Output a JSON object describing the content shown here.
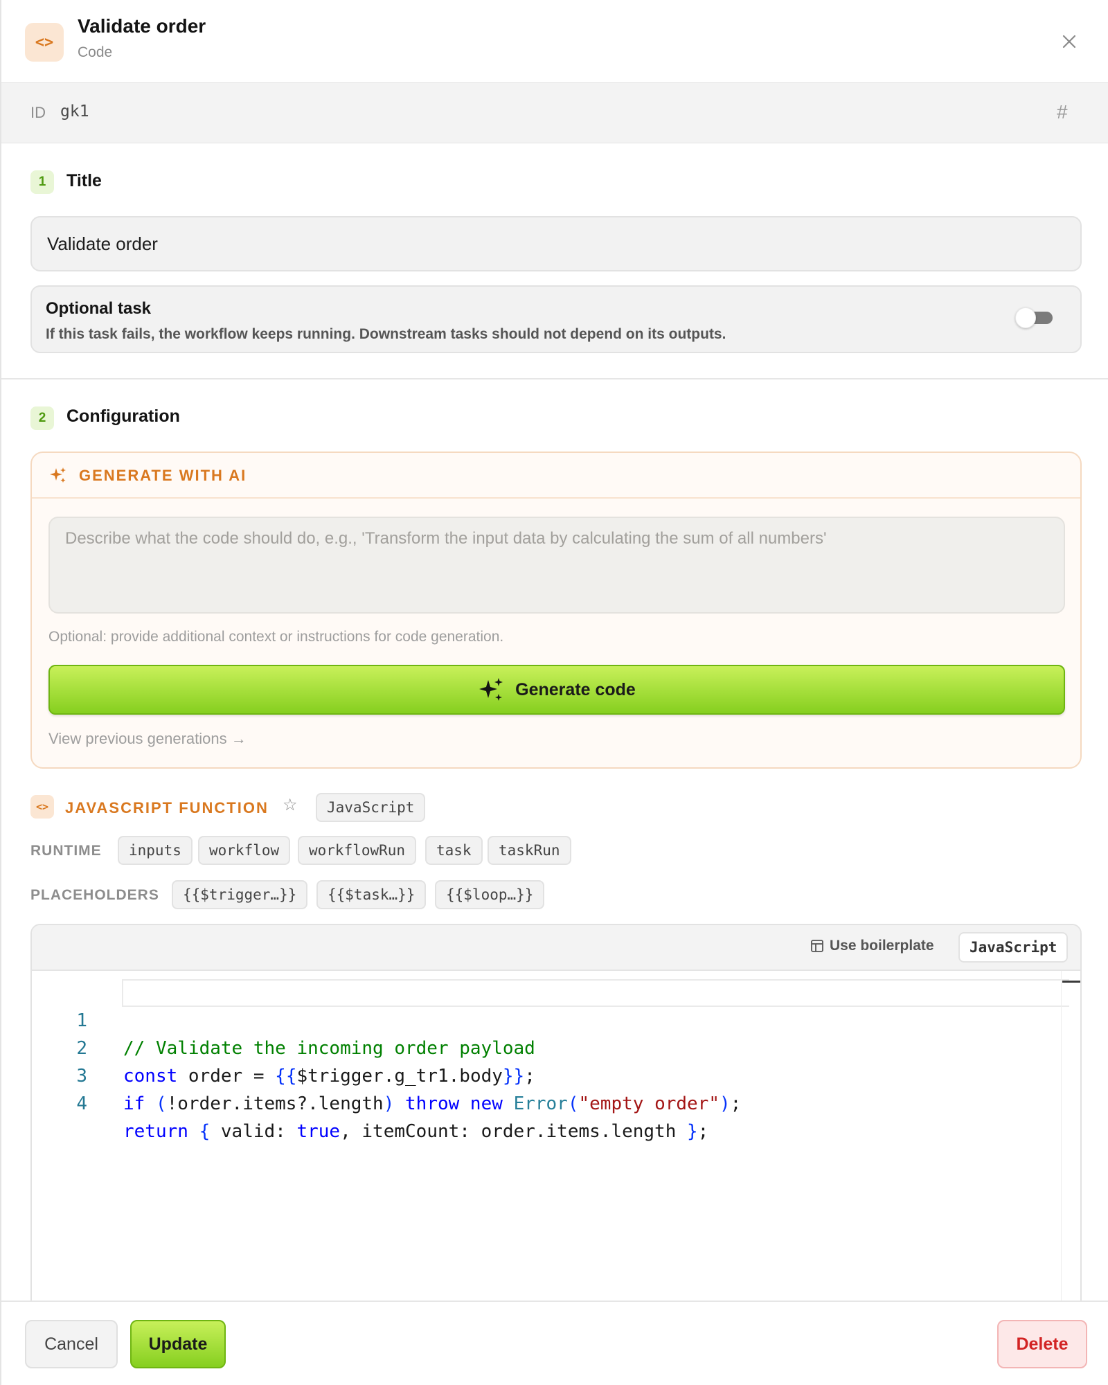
{
  "header": {
    "title": "Validate order",
    "subtitle": "Code",
    "icon": "code-icon"
  },
  "id_bar": {
    "label": "ID",
    "value": "gk1"
  },
  "sections": {
    "title": {
      "step": "1",
      "heading": "Title"
    },
    "configuration": {
      "step": "2",
      "heading": "Configuration"
    }
  },
  "title_input": {
    "value": "Validate order"
  },
  "optional_task": {
    "title": "Optional task",
    "description": "If this task fails, the workflow keeps running. Downstream tasks should not depend on its outputs.",
    "enabled": false
  },
  "ai": {
    "heading": "GENERATE WITH AI",
    "placeholder": "Describe what the code should do, e.g., 'Transform the input data by calculating the sum of all numbers'",
    "hint": "Optional: provide additional context or instructions for code generation.",
    "generate_label": "Generate code",
    "view_previous": "View previous generations →"
  },
  "function": {
    "title": "JAVASCRIPT FUNCTION",
    "language_chip": "JavaScript",
    "runtime_label": "RUNTIME",
    "runtime_chips": [
      "inputs",
      "workflow",
      "workflowRun",
      "task",
      "taskRun"
    ],
    "placeholders_label": "PLACEHOLDERS",
    "placeholder_chips": [
      "{{$trigger…}}",
      "{{$task…}}",
      "{{$loop…}}"
    ]
  },
  "editor": {
    "boilerplate_label": "Use boilerplate",
    "language": "JavaScript",
    "lines": [
      "// Validate the incoming order payload",
      "const order = {{$trigger.g_tr1.body}};",
      "if (!order.items?.length) throw new Error(\"empty order\");",
      "return { valid: true, itemCount: order.items.length };"
    ],
    "line_numbers": [
      "1",
      "2",
      "3",
      "4"
    ]
  },
  "footer": {
    "cancel": "Cancel",
    "update": "Update",
    "delete": "Delete"
  },
  "colors": {
    "accent_orange": "#d9781f",
    "accent_green": "#86cf1f",
    "danger_red": "#d22323"
  }
}
